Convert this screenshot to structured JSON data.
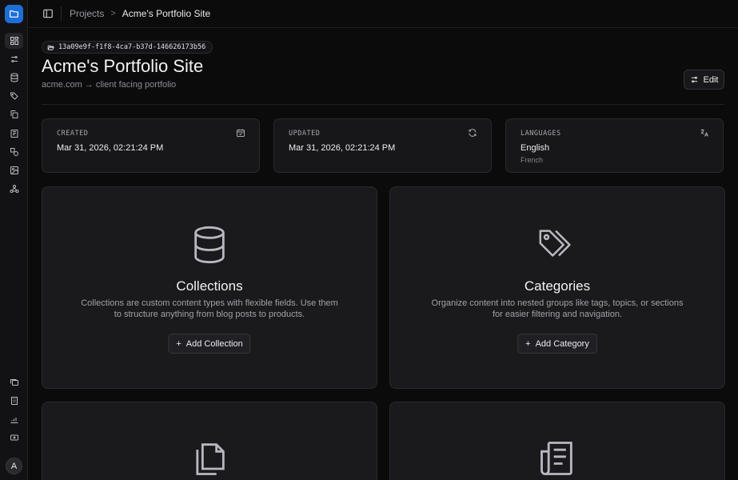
{
  "sidebar": {
    "logo_icon": "folder-icon",
    "items": [
      {
        "icon": "dashboard-icon",
        "active": true
      },
      {
        "icon": "sliders-icon",
        "active": false
      },
      {
        "icon": "database-icon",
        "active": false
      },
      {
        "icon": "tags-icon",
        "active": false
      },
      {
        "icon": "copy-icon",
        "active": false
      },
      {
        "icon": "newspaper-icon",
        "active": false
      },
      {
        "icon": "shapes-icon",
        "active": false
      },
      {
        "icon": "images-icon",
        "active": false
      },
      {
        "icon": "webhook-icon",
        "active": false
      }
    ],
    "bottom_items": [
      {
        "icon": "gallery-icon"
      },
      {
        "icon": "building-icon"
      },
      {
        "icon": "chart-icon"
      },
      {
        "icon": "banknote-icon"
      }
    ],
    "avatar_initial": "A"
  },
  "topbar": {
    "breadcrumb": {
      "projects": "Projects",
      "separator": ">",
      "current": "Acme's Portfolio Site"
    }
  },
  "header": {
    "project_id": "13a09e9f-f1f8-4ca7-b37d-146626173b56",
    "title": "Acme's Portfolio Site",
    "subtitle": "acme.com → client facing portfolio",
    "edit_label": "Edit"
  },
  "info": {
    "created": {
      "label": "CREATED",
      "value": "Mar 31, 2026, 02:21:24 PM"
    },
    "updated": {
      "label": "UPDATED",
      "value": "Mar 31, 2026, 02:21:24 PM"
    },
    "languages": {
      "label": "LANGUAGES",
      "primary": "English",
      "secondary": "French"
    }
  },
  "features": {
    "collections": {
      "title": "Collections",
      "desc_line1": "Collections are custom content types with flexible fields. Use them",
      "desc_line2": "to structure anything from blog posts to products.",
      "button": "Add Collection"
    },
    "categories": {
      "title": "Categories",
      "desc_line1": "Organize content into nested groups like tags, topics, or sections",
      "desc_line2": "for easier filtering and navigation.",
      "button": "Add Category"
    }
  },
  "colors": {
    "accent": "#1d6fd6",
    "background": "#0b0b0c",
    "card": "#1a1a1d"
  }
}
